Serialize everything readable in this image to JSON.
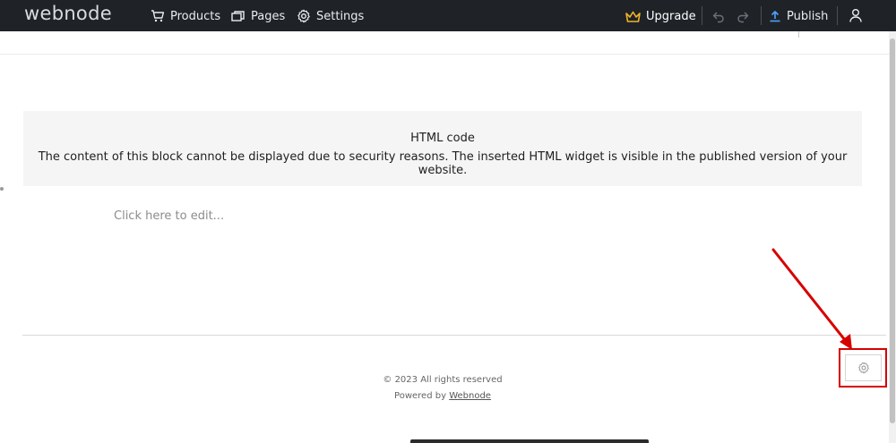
{
  "topbar": {
    "logo": "webnode",
    "nav": {
      "products": "Products",
      "pages": "Pages",
      "settings": "Settings"
    },
    "upgrade": "Upgrade",
    "publish": "Publish"
  },
  "content": {
    "html_block": {
      "title": "HTML code",
      "message": "The content of this block cannot be displayed due to security reasons. The inserted HTML widget is visible in the published version of your website."
    },
    "edit_placeholder": "Click here to edit..."
  },
  "footer": {
    "copyright": "© 2023 All rights reserved",
    "powered_prefix": "Powered by ",
    "powered_link": "Webnode"
  },
  "colors": {
    "topbar_bg": "#1f2328",
    "upgrade_crown": "#f0b429",
    "publish_icon": "#4da3ff",
    "annotation_red": "#d60000"
  },
  "icons": {
    "products": "cart-icon",
    "pages": "pages-icon",
    "settings": "gear-icon",
    "upgrade": "crown-icon",
    "undo": "undo-icon",
    "redo": "redo-icon",
    "publish": "upload-icon",
    "user": "user-icon",
    "block_settings": "gear-icon"
  }
}
